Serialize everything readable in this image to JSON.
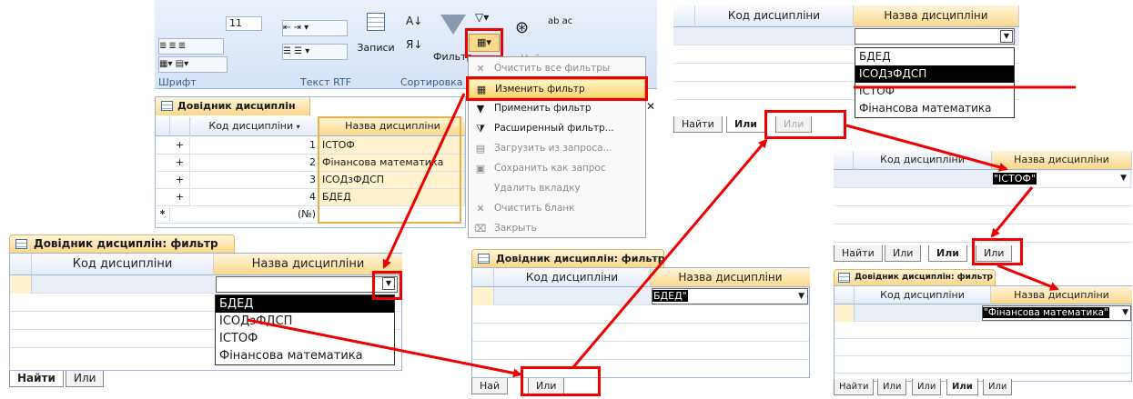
{
  "ribbon": {
    "font_size": "11",
    "font_group": "Шрифт",
    "rtf_group": "Текст RTF",
    "records_label": "Записи",
    "sort_group": "Сортировка",
    "filter_label": "Фильтр",
    "find_label": "Найти"
  },
  "datasheet": {
    "title": "Довідник дисциплін",
    "col_code": "Код дисципліни",
    "col_name": "Назва дисципліни",
    "rows": [
      {
        "code": "1",
        "name": "ІСТОФ"
      },
      {
        "code": "2",
        "name": "Фінансова математика"
      },
      {
        "code": "3",
        "name": "ІСОДзФДСП"
      },
      {
        "code": "4",
        "name": "БДЕД"
      }
    ],
    "new_row_code": "(№)",
    "new_row_marker": "*",
    "expand_marker": "+"
  },
  "menu": {
    "items": [
      {
        "label": "Очистить все фильтры",
        "icon": "clear-filters-icon",
        "glyph": "✕",
        "disabled": true
      },
      {
        "label": "Изменить фильтр",
        "icon": "edit-filter-icon",
        "glyph": "▦",
        "hot": true
      },
      {
        "label": "Применить фильтр",
        "icon": "apply-filter-icon",
        "glyph": "▼"
      },
      {
        "label": "Расширенный фильтр...",
        "icon": "advanced-filter-icon",
        "glyph": "⧩"
      },
      {
        "label": "Загрузить из запроса...",
        "icon": "load-query-icon",
        "glyph": "▤",
        "disabled": true
      },
      {
        "label": "Сохранить как запрос",
        "icon": "save-query-icon",
        "glyph": "▣",
        "disabled": true
      },
      {
        "label": "Удалить вкладку",
        "icon": "delete-tab-icon",
        "glyph": "",
        "disabled": true
      },
      {
        "label": "Очистить бланк",
        "icon": "clear-grid-icon",
        "glyph": "✕",
        "disabled": true
      },
      {
        "label": "Закрыть",
        "icon": "close-icon",
        "glyph": "⌧",
        "disabled": true
      }
    ]
  },
  "filter_main": {
    "title": "Довідник дисциплін: фильтр",
    "col_code": "Код дисципліни",
    "col_name": "Назва дисципліни",
    "options": [
      "БДЕД",
      "ІСОДзФДСП",
      "ІСТОФ",
      "Фінансова математика"
    ],
    "tabs": [
      "Найти",
      "Или"
    ]
  },
  "filter_top": {
    "col_code": "Код дисципліни",
    "col_name": "Назва дисципліни",
    "options": [
      "БДЕД",
      "ІСОДзФДСП",
      "ІСТОФ",
      "Фінансова математика"
    ],
    "tabs": [
      "Найти",
      "Или",
      "Или"
    ]
  },
  "filter_mid": {
    "title": "Довідник дисциплін: фильтр",
    "col_code": "Код дисципліни",
    "col_name": "Назва дисципліни",
    "value": "БДЕД\"",
    "tabs": [
      "Най",
      "Или"
    ]
  },
  "filter_r1": {
    "col_code": "Код дисципліни",
    "col_name": "Назва дисципліни",
    "value": "\"ІСТОФ\"",
    "tabs": [
      "Найти",
      "Или",
      "Или",
      "Или"
    ]
  },
  "filter_r2": {
    "title": "Довідник дисциплін: фильтр",
    "col_code": "Код дисципліни",
    "col_name": "Назва дисципліни",
    "value": "\"Фінансова математика\"",
    "tabs": [
      "Найти",
      "Или",
      "Или",
      "Или",
      "Или"
    ]
  },
  "colors": {
    "accent": "#e00000",
    "header": "#e3ebf6",
    "highlight": "#fcd770"
  }
}
